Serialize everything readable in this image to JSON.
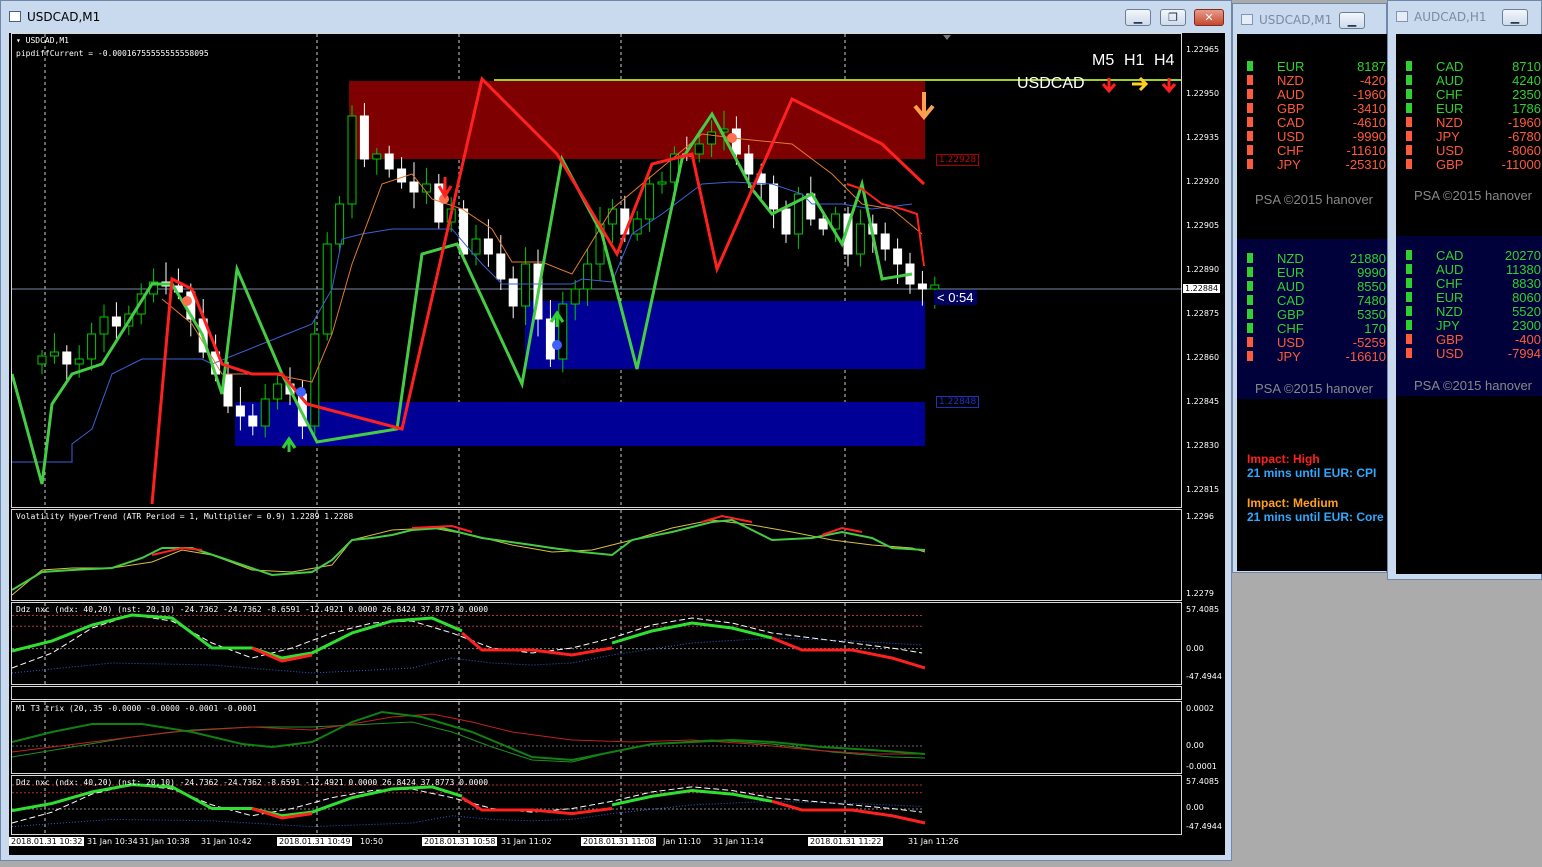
{
  "main_window": {
    "title": "USDCAD,M1",
    "chart_header": "USDCAD,M1",
    "pipdiff": "pipdiffCurrent = -0.00016755555555558095",
    "symbol_overlay": "USDCAD",
    "tf_labels": [
      "M5",
      "H1",
      "H4"
    ],
    "levels": {
      "upper": "1.22928",
      "lower": "1.22848"
    },
    "countdown": "< 0:54",
    "current_price": "1.22884",
    "price_axis": [
      "1.22965",
      "1.22950",
      "1.22935",
      "1.22920",
      "1.22905",
      "1.22890",
      "1.22875",
      "1.22860",
      "1.22845",
      "1.22830",
      "1.22815"
    ],
    "time_axis": [
      {
        "text": "2018.01.31 10:32",
        "boxed": true
      },
      {
        "text": "31 Jan 10:34",
        "boxed": false
      },
      {
        "text": "31 Jan 10:38",
        "boxed": false
      },
      {
        "text": "31 Jan 10:42",
        "boxed": false
      },
      {
        "text": "2018.01.31 10:49",
        "boxed": true
      },
      {
        "text": "10:50",
        "boxed": false
      },
      {
        "text": "2018.01.31 10:58",
        "boxed": true
      },
      {
        "text": "31 Jan 11:02",
        "boxed": false
      },
      {
        "text": "2018.01.31 11:08",
        "boxed": true
      },
      {
        "text": "Jan 11:10",
        "boxed": false
      },
      {
        "text": "31 Jan 11:14",
        "boxed": false
      },
      {
        "text": "2018.01.31 11:22",
        "boxed": true
      },
      {
        "text": "31 Jan 11:26",
        "boxed": false
      }
    ],
    "indicators": {
      "hypertrend": {
        "name": "Volatility HyperTrend (ATR Period = 1, Multiplier = 0.9) 1.2289 1.2288",
        "axis": [
          "1.2296",
          "1.2279"
        ]
      },
      "ddz1": {
        "name": "Ddz nxc (ndx: 40,20) (nst: 20,10) -24.7362 -24.7362 -8.6591 -12.4921 0.0000 26.8424 37.8773 0.0000",
        "axis": [
          "57.4085",
          "0.00",
          "-47.4944"
        ]
      },
      "t3trix": {
        "name": "M1 T3 trix (20,.35 -0.0000 -0.0000 -0.0001 -0.0001",
        "axis": [
          "0.0002",
          "0.00",
          "-0.0001"
        ]
      },
      "ddz2": {
        "name": "Ddz nxc (ndx: 40,20) (nst: 20,10) -24.7362 -24.7362 -8.6591 -12.4921 0.0000 26.8424 37.8773 0.0000",
        "axis": [
          "57.4085",
          "0.00",
          "-47.4944"
        ]
      }
    }
  },
  "side_window_1": {
    "title": "USDCAD,M1",
    "strength_top": [
      {
        "ccy": "EUR",
        "val": "8187",
        "c": "green"
      },
      {
        "ccy": "NZD",
        "val": "-420",
        "c": "red"
      },
      {
        "ccy": "AUD",
        "val": "-1960",
        "c": "red"
      },
      {
        "ccy": "GBP",
        "val": "-3410",
        "c": "red"
      },
      {
        "ccy": "CAD",
        "val": "-4610",
        "c": "red"
      },
      {
        "ccy": "USD",
        "val": "-9990",
        "c": "red"
      },
      {
        "ccy": "CHF",
        "val": "-11610",
        "c": "red"
      },
      {
        "ccy": "JPY",
        "val": "-25310",
        "c": "red"
      }
    ],
    "strength_bottom": [
      {
        "ccy": "NZD",
        "val": "21880",
        "c": "green"
      },
      {
        "ccy": "EUR",
        "val": "9990",
        "c": "green"
      },
      {
        "ccy": "AUD",
        "val": "8550",
        "c": "green"
      },
      {
        "ccy": "CAD",
        "val": "7480",
        "c": "green"
      },
      {
        "ccy": "GBP",
        "val": "5350",
        "c": "green"
      },
      {
        "ccy": "CHF",
        "val": "170",
        "c": "green"
      },
      {
        "ccy": "USD",
        "val": "-5259",
        "c": "red"
      },
      {
        "ccy": "JPY",
        "val": "-16610",
        "c": "red"
      }
    ],
    "psa": "PSA ©2015 hanover",
    "news": [
      {
        "label": "Impact: High",
        "detail": "21 mins until EUR: CPI"
      },
      {
        "label": "Impact: Medium",
        "detail": "21 mins until EUR: Core"
      }
    ]
  },
  "side_window_2": {
    "title": "AUDCAD,H1",
    "strength_top": [
      {
        "ccy": "CAD",
        "val": "8710",
        "c": "green"
      },
      {
        "ccy": "AUD",
        "val": "4240",
        "c": "green"
      },
      {
        "ccy": "CHF",
        "val": "2350",
        "c": "green"
      },
      {
        "ccy": "EUR",
        "val": "1786",
        "c": "green"
      },
      {
        "ccy": "NZD",
        "val": "-1960",
        "c": "red"
      },
      {
        "ccy": "JPY",
        "val": "-6780",
        "c": "red"
      },
      {
        "ccy": "USD",
        "val": "-8060",
        "c": "red"
      },
      {
        "ccy": "GBP",
        "val": "-11000",
        "c": "red"
      }
    ],
    "strength_bottom": [
      {
        "ccy": "CAD",
        "val": "20270",
        "c": "green"
      },
      {
        "ccy": "AUD",
        "val": "11380",
        "c": "green"
      },
      {
        "ccy": "CHF",
        "val": "8830",
        "c": "green"
      },
      {
        "ccy": "EUR",
        "val": "8060",
        "c": "green"
      },
      {
        "ccy": "NZD",
        "val": "5520",
        "c": "green"
      },
      {
        "ccy": "JPY",
        "val": "2300",
        "c": "green"
      },
      {
        "ccy": "GBP",
        "val": "-400",
        "c": "red"
      },
      {
        "ccy": "USD",
        "val": "-7994",
        "c": "red"
      }
    ],
    "psa": "PSA ©2015 hanover"
  },
  "colors": {
    "bull": "#ffffff",
    "bear": "#00cc00",
    "red_zone": "#7f0000",
    "blue_zone": "#000096",
    "trend_green": "#44cc44",
    "trend_red": "#ff2020",
    "text_green": "#30d030",
    "text_red": "#ff5a3c"
  }
}
